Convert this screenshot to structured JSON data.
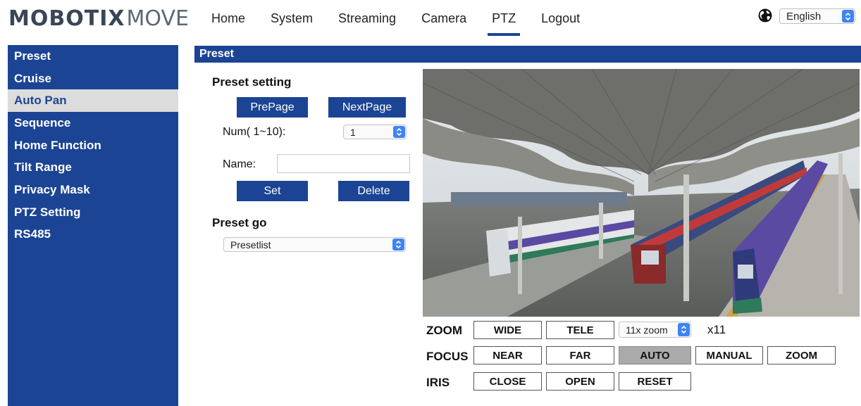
{
  "brand": {
    "logo_part1": "MOBOTIX",
    "logo_part2": "MOVE"
  },
  "nav": {
    "items": [
      {
        "label": "Home"
      },
      {
        "label": "System"
      },
      {
        "label": "Streaming"
      },
      {
        "label": "Camera"
      },
      {
        "label": "PTZ"
      },
      {
        "label": "Logout"
      }
    ],
    "active": "PTZ"
  },
  "language": {
    "selected": "English"
  },
  "sidebar": {
    "items": [
      {
        "label": "Preset"
      },
      {
        "label": "Cruise"
      },
      {
        "label": "Auto Pan"
      },
      {
        "label": "Sequence"
      },
      {
        "label": "Home Function"
      },
      {
        "label": "Tilt Range"
      },
      {
        "label": "Privacy Mask"
      },
      {
        "label": "PTZ Setting"
      },
      {
        "label": "RS485"
      }
    ],
    "active": "Auto Pan"
  },
  "section": {
    "title": "Preset"
  },
  "preset_setting": {
    "heading": "Preset setting",
    "prev_page_label": "PrePage",
    "next_page_label": "NextPage",
    "num_label": "Num( 1~10):",
    "num_value": "1",
    "name_label": "Name:",
    "name_value": "",
    "set_label": "Set",
    "delete_label": "Delete"
  },
  "preset_go": {
    "heading": "Preset go",
    "selected": "Presetlist"
  },
  "controls": {
    "zoom": {
      "label": "ZOOM",
      "wide": "WIDE",
      "tele": "TELE",
      "zoom_select": "11x zoom",
      "value": "x11"
    },
    "focus": {
      "label": "FOCUS",
      "near": "NEAR",
      "far": "FAR",
      "auto": "AUTO",
      "manual": "MANUAL",
      "zoom": "ZOOM",
      "active": "AUTO"
    },
    "iris": {
      "label": "IRIS",
      "close": "CLOSE",
      "open": "OPEN",
      "reset": "RESET"
    }
  },
  "colors": {
    "brand_blue": "#1c4495",
    "select_chevron": "#3d84f6",
    "active_button": "#aaaaaa",
    "sidebar_active_bg": "#dcdcdc"
  },
  "icons": {
    "globe": "globe-icon",
    "chevron": "chevron-updown-icon"
  }
}
